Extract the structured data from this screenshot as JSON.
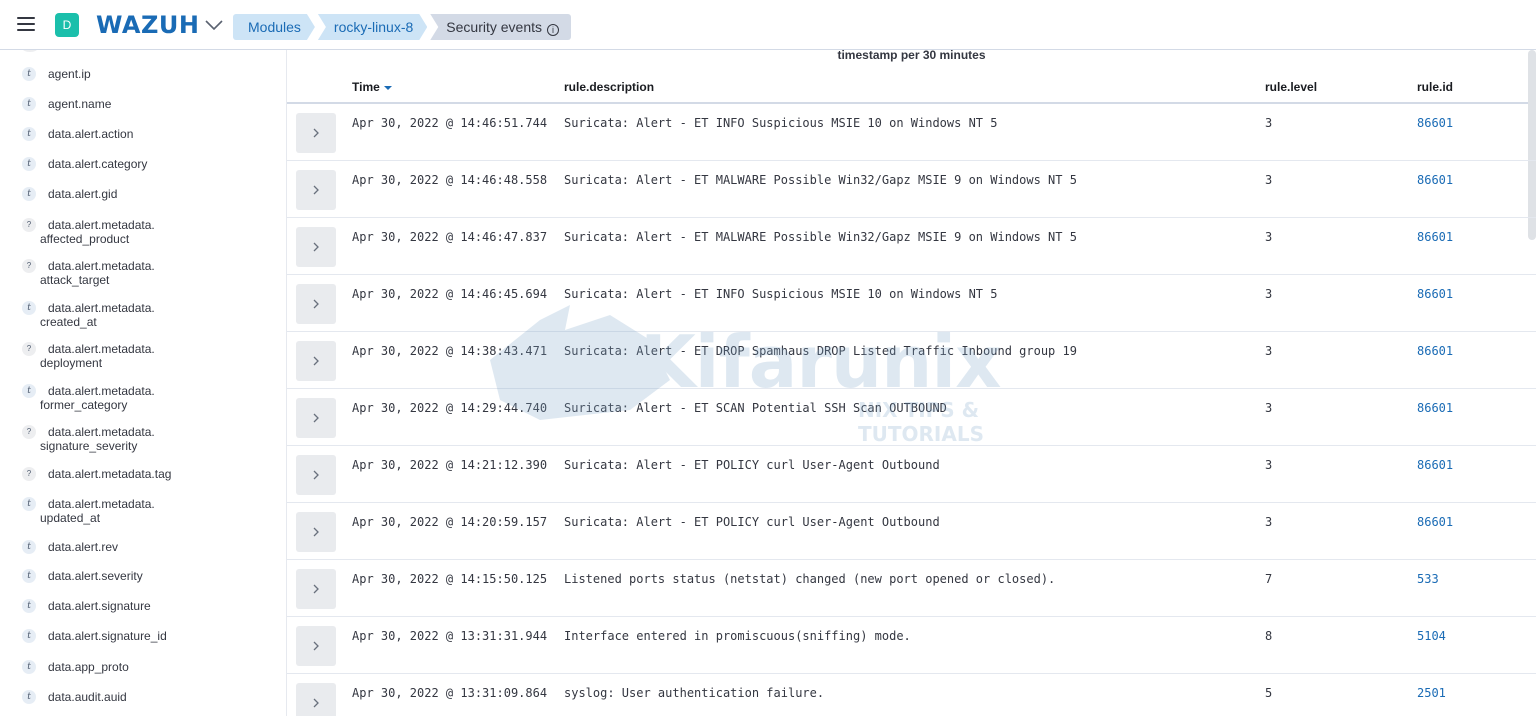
{
  "header": {
    "avatar_letter": "D",
    "logo_text": "WAZUH",
    "breadcrumbs": [
      "Modules",
      "rocky-linux-8",
      "Security events"
    ],
    "info_icon": "info-circle-icon",
    "accent_color": "#1a6bb5",
    "avatar_color": "#1bbfab"
  },
  "sidebar": {
    "fields": [
      {
        "type": "t",
        "label": "agent.ip",
        "label2": ""
      },
      {
        "type": "t",
        "label": "agent.name",
        "label2": ""
      },
      {
        "type": "t",
        "label": "data.alert.action",
        "label2": ""
      },
      {
        "type": "t",
        "label": "data.alert.category",
        "label2": ""
      },
      {
        "type": "t",
        "label": "data.alert.gid",
        "label2": ""
      },
      {
        "type": "?",
        "label": "data.alert.metadata.",
        "label2": "affected_product"
      },
      {
        "type": "?",
        "label": "data.alert.metadata.",
        "label2": "attack_target"
      },
      {
        "type": "t",
        "label": "data.alert.metadata.",
        "label2": "created_at"
      },
      {
        "type": "?",
        "label": "data.alert.metadata.",
        "label2": "deployment"
      },
      {
        "type": "t",
        "label": "data.alert.metadata.",
        "label2": "former_category"
      },
      {
        "type": "?",
        "label": "data.alert.metadata.",
        "label2": "signature_severity"
      },
      {
        "type": "?",
        "label": "data.alert.metadata.tag",
        "label2": ""
      },
      {
        "type": "t",
        "label": "data.alert.metadata.",
        "label2": "updated_at"
      },
      {
        "type": "t",
        "label": "data.alert.rev",
        "label2": ""
      },
      {
        "type": "t",
        "label": "data.alert.severity",
        "label2": ""
      },
      {
        "type": "t",
        "label": "data.alert.signature",
        "label2": ""
      },
      {
        "type": "t",
        "label": "data.alert.signature_id",
        "label2": ""
      },
      {
        "type": "t",
        "label": "data.app_proto",
        "label2": ""
      },
      {
        "type": "t",
        "label": "data.audit.auid",
        "label2": ""
      }
    ]
  },
  "main": {
    "chart_caption": "timestamp per 30 minutes",
    "columns": {
      "time": "Time",
      "description": "rule.description",
      "level": "rule.level",
      "id": "rule.id"
    },
    "rows": [
      {
        "time": "Apr 30, 2022 @ 14:46:51.744",
        "description": "Suricata: Alert - ET INFO Suspicious MSIE 10 on Windows NT 5",
        "level": "3",
        "id": "86601"
      },
      {
        "time": "Apr 30, 2022 @ 14:46:48.558",
        "description": "Suricata: Alert - ET MALWARE Possible Win32/Gapz MSIE 9 on Windows NT 5",
        "level": "3",
        "id": "86601"
      },
      {
        "time": "Apr 30, 2022 @ 14:46:47.837",
        "description": "Suricata: Alert - ET MALWARE Possible Win32/Gapz MSIE 9 on Windows NT 5",
        "level": "3",
        "id": "86601"
      },
      {
        "time": "Apr 30, 2022 @ 14:46:45.694",
        "description": "Suricata: Alert - ET INFO Suspicious MSIE 10 on Windows NT 5",
        "level": "3",
        "id": "86601"
      },
      {
        "time": "Apr 30, 2022 @ 14:38:43.471",
        "description": "Suricata: Alert - ET DROP Spamhaus DROP Listed Traffic Inbound group 19",
        "level": "3",
        "id": "86601"
      },
      {
        "time": "Apr 30, 2022 @ 14:29:44.740",
        "description": "Suricata: Alert - ET SCAN Potential SSH Scan OUTBOUND",
        "level": "3",
        "id": "86601"
      },
      {
        "time": "Apr 30, 2022 @ 14:21:12.390",
        "description": "Suricata: Alert - ET POLICY curl User-Agent Outbound",
        "level": "3",
        "id": "86601"
      },
      {
        "time": "Apr 30, 2022 @ 14:20:59.157",
        "description": "Suricata: Alert - ET POLICY curl User-Agent Outbound",
        "level": "3",
        "id": "86601"
      },
      {
        "time": "Apr 30, 2022 @ 14:15:50.125",
        "description": "Listened ports status (netstat) changed (new port opened or closed).",
        "level": "7",
        "id": "533"
      },
      {
        "time": "Apr 30, 2022 @ 13:31:31.944",
        "description": "Interface entered in promiscuous(sniffing) mode.",
        "level": "8",
        "id": "5104"
      },
      {
        "time": "Apr 30, 2022 @ 13:31:09.864",
        "description": "syslog: User authentication failure.",
        "level": "5",
        "id": "2501"
      }
    ]
  },
  "watermark": {
    "title": "Kifarunix",
    "subtitle": "NIX TIPS & TUTORIALS"
  }
}
